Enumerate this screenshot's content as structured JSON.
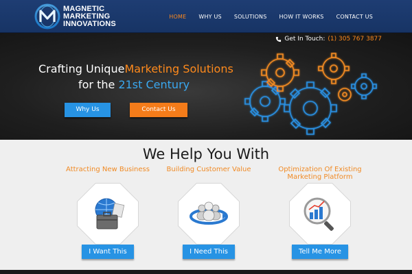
{
  "brand": {
    "line1": "MAGNETIC",
    "line2": "MARKETING",
    "line3": "INNOVATIONS",
    "logo_icon": "magnetic-m-logo"
  },
  "nav": [
    {
      "label": "HOME",
      "active": true
    },
    {
      "label": "WHY US",
      "active": false
    },
    {
      "label": "SOLUTIONS",
      "active": false
    },
    {
      "label": "HOW IT WORKS",
      "active": false
    },
    {
      "label": "CONTACT US",
      "active": false
    }
  ],
  "contact": {
    "label": "Get In Touch:",
    "phone": "(1) 305 767 3877",
    "icon": "phone-icon"
  },
  "hero": {
    "line1_a": "Crafting Unique",
    "line1_b": "Marketing Solutions",
    "line2_a": "for the",
    "line2_b": "21st Century",
    "btn_why": "Why Us",
    "btn_contact": "Contact Us",
    "illustration": "gears-icon"
  },
  "services": {
    "title": "We Help You With",
    "items": [
      {
        "title": "Attracting New Business",
        "button": "I Want This",
        "icon": "briefcase-globe-icon"
      },
      {
        "title": "Building Customer Value",
        "button": "I Need This",
        "icon": "customers-icon"
      },
      {
        "title_line1": "Optimization Of Existing",
        "title_line2": "Marketing Platform",
        "button": "Tell Me More",
        "icon": "analytics-magnifier-icon"
      }
    ]
  },
  "colors": {
    "header_bg": "#1e3d73",
    "accent_orange": "#ff8a1c",
    "accent_blue": "#2793e4",
    "hero_bg": "#1f1f1f"
  }
}
